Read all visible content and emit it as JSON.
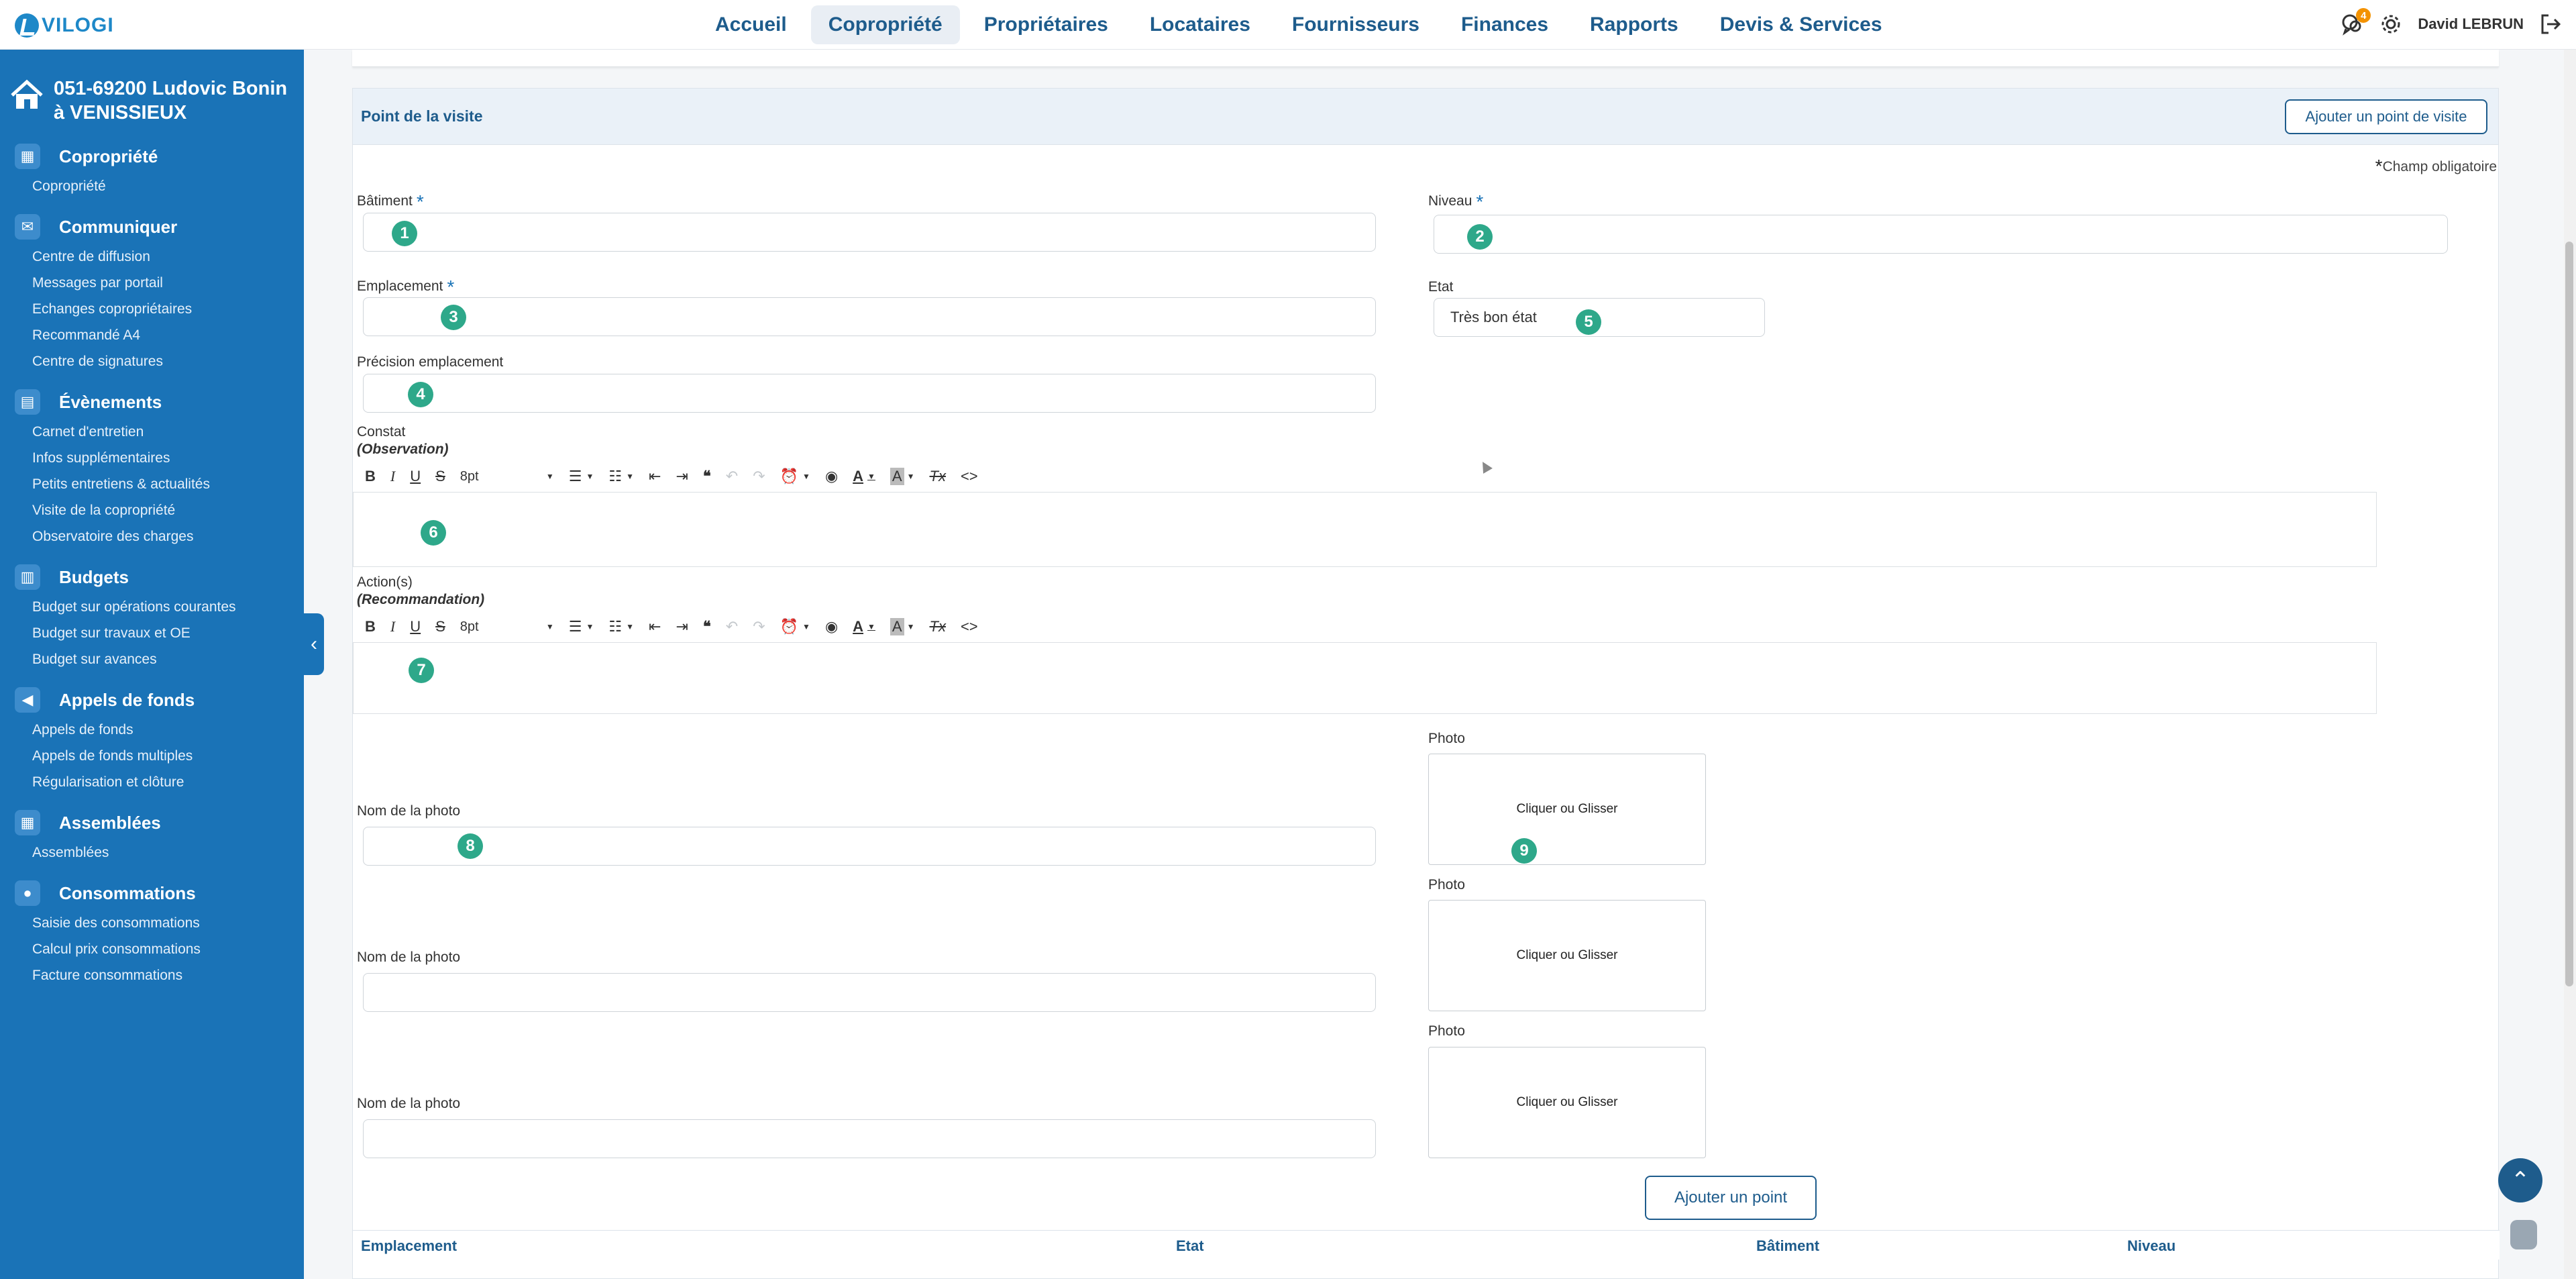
{
  "app": {
    "logo_text": "VILOGI"
  },
  "nav": {
    "items": [
      "Accueil",
      "Copropriété",
      "Propriétaires",
      "Locataires",
      "Fournisseurs",
      "Finances",
      "Rapports",
      "Devis & Services"
    ],
    "active": "Copropriété"
  },
  "topright": {
    "notifications_count": "4",
    "user_name": "David LEBRUN"
  },
  "sidebar": {
    "title": "051-69200 Ludovic Bonin à VENISSIEUX",
    "sections": [
      {
        "title": "Copropriété",
        "icon": "grid-icon",
        "items": [
          "Copropriété"
        ]
      },
      {
        "title": "Communiquer",
        "icon": "mail-icon",
        "items": [
          "Centre de diffusion",
          "Messages par portail",
          "Echanges copropriétaires",
          "Recommandé A4",
          "Centre de signatures"
        ]
      },
      {
        "title": "Évènements",
        "icon": "calendar-icon",
        "items": [
          "Carnet d'entretien",
          "Infos supplémentaires",
          "Petits entretiens & actualités",
          "Visite de la copropriété",
          "Observatoire des charges"
        ]
      },
      {
        "title": "Budgets",
        "icon": "calculator-icon",
        "items": [
          "Budget sur opérations courantes",
          "Budget sur travaux et OE",
          "Budget sur avances"
        ]
      },
      {
        "title": "Appels de fonds",
        "icon": "megaphone-icon",
        "items": [
          "Appels de fonds",
          "Appels de fonds multiples",
          "Régularisation et clôture"
        ]
      },
      {
        "title": "Assemblées",
        "icon": "grid-icon",
        "items": [
          "Assemblées"
        ]
      },
      {
        "title": "Consommations",
        "icon": "drop-icon",
        "items": [
          "Saisie des consommations",
          "Calcul prix consommations",
          "Facture consommations"
        ]
      }
    ]
  },
  "card": {
    "title": "Point de la visite",
    "add_visit_button": "Ajouter un point de visite",
    "required_note": "Champ obligatoire",
    "required_star": "*"
  },
  "form": {
    "batiment_label": "Bâtiment",
    "niveau_label": "Niveau",
    "emplacement_label": "Emplacement",
    "etat_label": "Etat",
    "etat_value": "Très bon état",
    "precision_label": "Précision emplacement",
    "constat_label": "Constat",
    "constat_sub": "(Observation)",
    "action_label": "Action(s)",
    "action_sub": "(Recommandation)",
    "font_size": "8pt",
    "photo_label": "Photo",
    "photo_name_label": "Nom de la photo",
    "dropzone_text": "Cliquer ou Glisser",
    "add_point_button": "Ajouter un point"
  },
  "markers": [
    "1",
    "2",
    "3",
    "4",
    "5",
    "6",
    "7",
    "8",
    "9"
  ],
  "table": {
    "columns": [
      "Emplacement",
      "Etat",
      "Bâtiment",
      "Niveau"
    ]
  }
}
